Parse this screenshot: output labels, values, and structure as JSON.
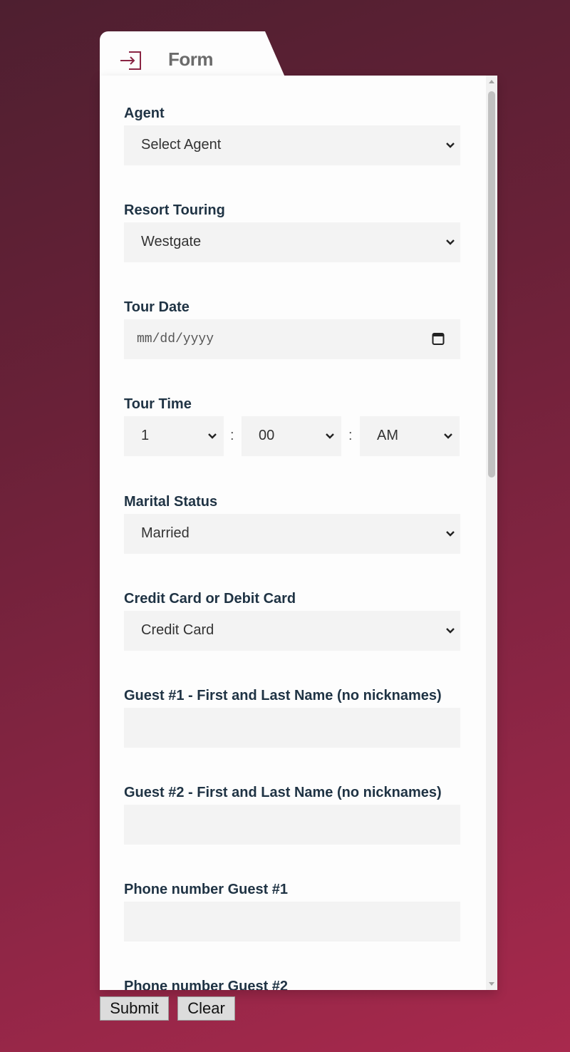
{
  "tab": {
    "title": "Form",
    "icon": "sign-in-icon"
  },
  "fields": {
    "agent": {
      "label": "Agent",
      "value": "Select Agent"
    },
    "resort": {
      "label": "Resort Touring",
      "value": "Westgate"
    },
    "tour_date": {
      "label": "Tour Date",
      "placeholder": "mm/dd/yyyy",
      "icon": "calendar-icon"
    },
    "tour_time": {
      "label": "Tour Time",
      "hour": "1",
      "minute": "00",
      "ampm": "AM",
      "separator": ":"
    },
    "marital": {
      "label": "Marital Status",
      "value": "Married"
    },
    "card": {
      "label": "Credit Card or Debit Card",
      "value": "Credit Card"
    },
    "guest1_name": {
      "label": "Guest #1 - First and Last Name (no nicknames)",
      "value": ""
    },
    "guest2_name": {
      "label": "Guest #2 - First and Last Name (no nicknames)",
      "value": ""
    },
    "phone1": {
      "label": "Phone number Guest #1",
      "value": ""
    },
    "phone2": {
      "label": "Phone number Guest #2"
    }
  },
  "buttons": {
    "submit": "Submit",
    "clear": "Clear"
  },
  "colors": {
    "label": "#1f3344",
    "field_bg": "#f3f3f3",
    "brand": "#8a2544"
  }
}
